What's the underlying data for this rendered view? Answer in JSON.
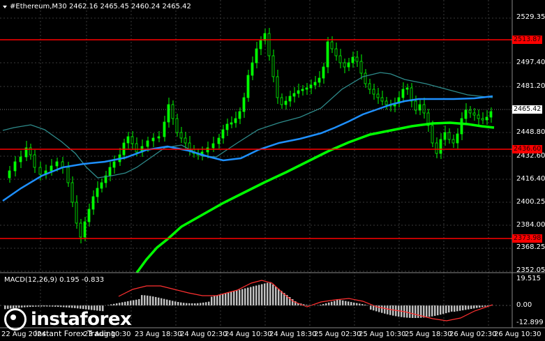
{
  "header": {
    "title": "#Ethereum,M30  2462.16 2465.45 2460.24 2465.42"
  },
  "macd": {
    "title": "MACD(12,26,9) 0.195 -0.833",
    "axis": [
      "19.515",
      "0.00",
      "-12.899"
    ]
  },
  "price_axis": {
    "ticks": [
      "2529.35",
      "2497.40",
      "2481.20",
      "2448.80",
      "2432.60",
      "2416.40",
      "2400.25",
      "2384.00",
      "2368.25",
      "2352.05"
    ]
  },
  "levels": {
    "resistance": "2513.87",
    "current": "2465.42",
    "support_1": "2436.60",
    "support_2": "2373.98"
  },
  "time_axis": {
    "labels": [
      "22 Aug 2024",
      "23 Aug 10:30",
      "23 Aug 18:30",
      "24 Aug 02:30",
      "24 Aug 10:30",
      "24 Aug 18:30",
      "25 Aug 02:30",
      "25 Aug 10:30",
      "25 Aug 18:30",
      "26 Aug 02:30",
      "26 Aug 10:30"
    ]
  },
  "branding": {
    "name": "instaforex",
    "tagline": "Instant Forex Trading"
  },
  "colors": {
    "background": "#000000",
    "candles": "#00ff00",
    "ma_fast": "#1e90ff",
    "ma_slow": "#00ff00",
    "ma_teal": "#2e8b8b",
    "level_lines": "#ff0000",
    "macd_hist": "#c0c0c0",
    "macd_signal": "#ff3030"
  }
}
